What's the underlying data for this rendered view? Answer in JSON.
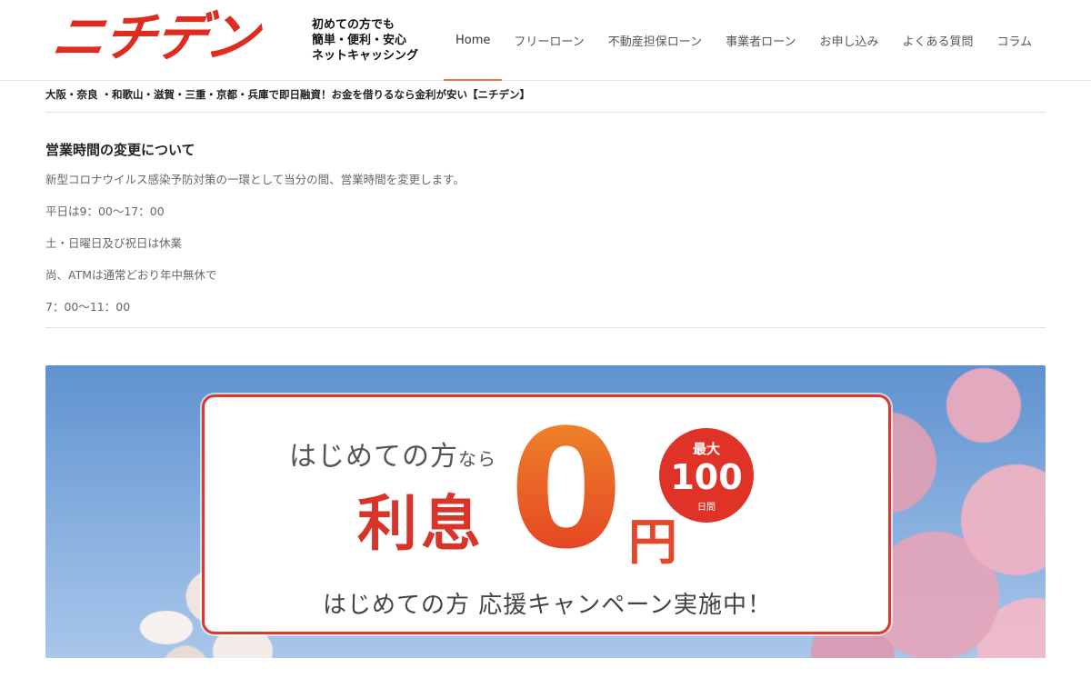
{
  "header": {
    "logo_text": "ニチデン",
    "tagline": [
      "初めての方でも",
      "簡単・便利・安心",
      "ネットキャッシング"
    ],
    "nav": [
      {
        "label": "Home",
        "active": true
      },
      {
        "label": "フリーローン",
        "active": false
      },
      {
        "label": "不動産担保ローン",
        "active": false
      },
      {
        "label": "事業者ローン",
        "active": false
      },
      {
        "label": "お申し込み",
        "active": false
      },
      {
        "label": "よくある質問",
        "active": false
      },
      {
        "label": "コラム",
        "active": false
      }
    ]
  },
  "breadcrumb": "大阪・奈良 ・和歌山・滋賀・三重・京都・兵庫で即日融資！お金を借りるなら金利が安い【ニチデン】",
  "notice": {
    "title": "営業時間の変更について",
    "lines": [
      "新型コロナウイルス感染予防対策の一環として当分の間、営業時間を変更します。",
      "平日は9：00～17：00",
      "土・日曜日及び祝日は休業",
      "尚、ATMは通常どおり年中無休で",
      "7：00～11：00"
    ]
  },
  "banner": {
    "line1_main": "はじめての方",
    "line1_small": "なら",
    "rishi": "利息",
    "zero": "0",
    "yen": "円",
    "badge_top": "最大",
    "badge_num": "100",
    "badge_unit": "日間",
    "line3": "はじめての方 応援キャンペーン実施中！"
  },
  "colors": {
    "brand_red": "#e02b20",
    "nav_active_underline": "#e1703a",
    "banner_sky": "#7da8dc"
  }
}
